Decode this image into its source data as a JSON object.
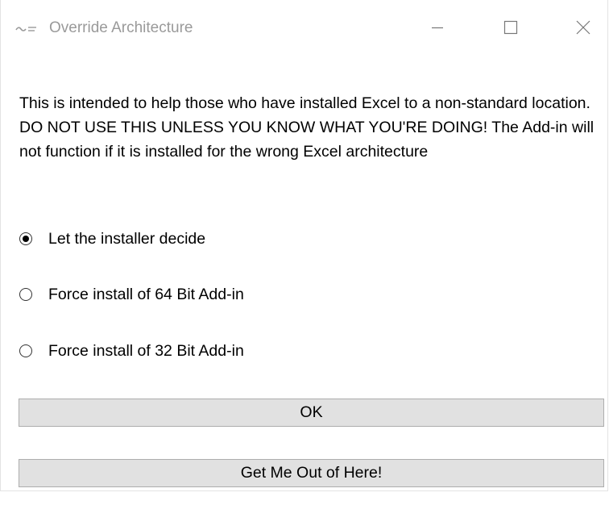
{
  "window": {
    "title": "Override Architecture",
    "controls": {
      "minimize": "minimize",
      "maximize": "maximize",
      "close": "close"
    }
  },
  "description": "This is intended to help those who have installed Excel to a non-standard location. DO NOT USE THIS UNLESS YOU KNOW WHAT YOU'RE DOING! The Add-in will not function if it is installed for the wrong Excel architecture",
  "options": [
    {
      "label": "Let the installer decide",
      "selected": true
    },
    {
      "label": "Force install of 64 Bit Add-in",
      "selected": false
    },
    {
      "label": "Force install of 32 Bit Add-in",
      "selected": false
    }
  ],
  "buttons": {
    "ok": "OK",
    "exit": "Get Me Out of Here!"
  },
  "colors": {
    "title_text": "#9a9a9a",
    "button_bg": "#e1e1e1",
    "button_border": "#adadad",
    "window_bg": "#ffffff"
  }
}
